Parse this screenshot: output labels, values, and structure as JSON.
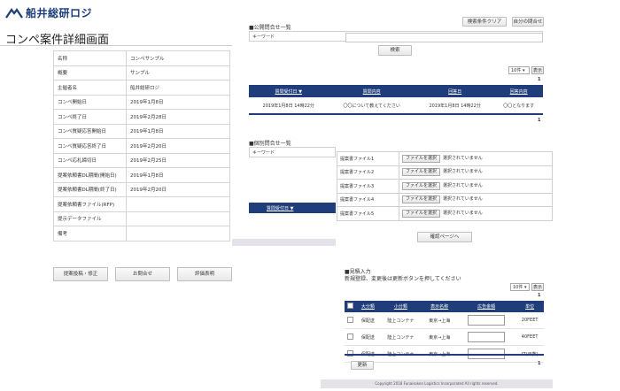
{
  "header": {
    "brand": "船井総研ロジ",
    "page_title": "コンペ案件詳細画面"
  },
  "detail": [
    {
      "label": "名称",
      "value": "コンペサンプル"
    },
    {
      "label": "概要",
      "value": "サンプル"
    },
    {
      "label": "主催者名",
      "value": "船井総研ロジ"
    },
    {
      "label": "コンペ開始日",
      "value": "2019年1月8日"
    },
    {
      "label": "コンペ終了日",
      "value": "2019年2月28日"
    },
    {
      "label": "コンペ質疑応答開始日",
      "value": "2019年1月8日"
    },
    {
      "label": "コンペ質疑応答終了日",
      "value": "2019年2月20日"
    },
    {
      "label": "コンペ応札締切日",
      "value": "2019年2月25日"
    },
    {
      "label": "提案依頼書DL期間(開始日)",
      "value": "2019年1月8日"
    },
    {
      "label": "提案依頼書DL期間(終了日)",
      "value": "2019年2月20日"
    },
    {
      "label": "提案依頼書ファイル(RFP)",
      "value": ""
    },
    {
      "label": "提示データファイル",
      "value": ""
    },
    {
      "label": "備考",
      "value": ""
    }
  ],
  "actions": {
    "submit": "提案投稿・修正",
    "inquiry": "お問合せ",
    "eval": "評価表明"
  },
  "public_inquiry": {
    "title": "■公開問合せ一覧",
    "clear_button": "検索条件クリア",
    "mine_button": "自分の問合せ",
    "keyword_label": "キーワード",
    "search_button": "検索",
    "per_page": "10件",
    "show_button": "表示",
    "page_top": "1",
    "page_bottom": "1",
    "columns": [
      "質問受付日 ▼",
      "質問内容",
      "回答日",
      "回答内容"
    ],
    "rows": [
      [
        "2019年1月8日 14時22分",
        "〇〇について教えてください",
        "2019年1月8日 14時22分",
        "〇〇となります"
      ]
    ]
  },
  "private_inquiry": {
    "title": "■個別問合せ一覧",
    "keyword_label": "キーワード",
    "column": "質問受付日 ▼"
  },
  "files": {
    "rows": [
      {
        "label": "提案書ファイル1",
        "button": "ファイルを選択",
        "status": "選択されていません"
      },
      {
        "label": "提案書ファイル2",
        "button": "ファイルを選択",
        "status": "選択されていません"
      },
      {
        "label": "提案書ファイル3",
        "button": "ファイルを選択",
        "status": "選択されていません"
      },
      {
        "label": "提案書ファイル4",
        "button": "ファイルを選択",
        "status": "選択されていません"
      },
      {
        "label": "提案書ファイル5",
        "button": "ファイルを選択",
        "status": "選択されていません"
      }
    ],
    "confirm_button": "確認ページへ"
  },
  "estimate": {
    "title": "■見積入力",
    "note": "新規登録、変更後は更新ボタンを押してください",
    "per_page": "10件",
    "show_button": "表示",
    "page_top": "1",
    "page_bottom": "1",
    "columns": [
      "大分類",
      "小分類",
      "表示名称",
      "広告金額",
      "単位"
    ],
    "rows": [
      [
        "保配送",
        "陸上コンテナ",
        "東京→上海",
        "20FEET"
      ],
      [
        "保配送",
        "陸上コンテナ",
        "東京→上海",
        "40FEET"
      ],
      [
        "保配送",
        "陸上コンテナ",
        "東京→上海",
        "LT(日数)"
      ]
    ],
    "update_button": "更新"
  },
  "footer": {
    "copyright": "Copyright 2018 Funaisoken Logistics Incorporated All rights reserved."
  },
  "colors": {
    "navy": "#1f3d7a",
    "brand": "#1b3d7a"
  }
}
